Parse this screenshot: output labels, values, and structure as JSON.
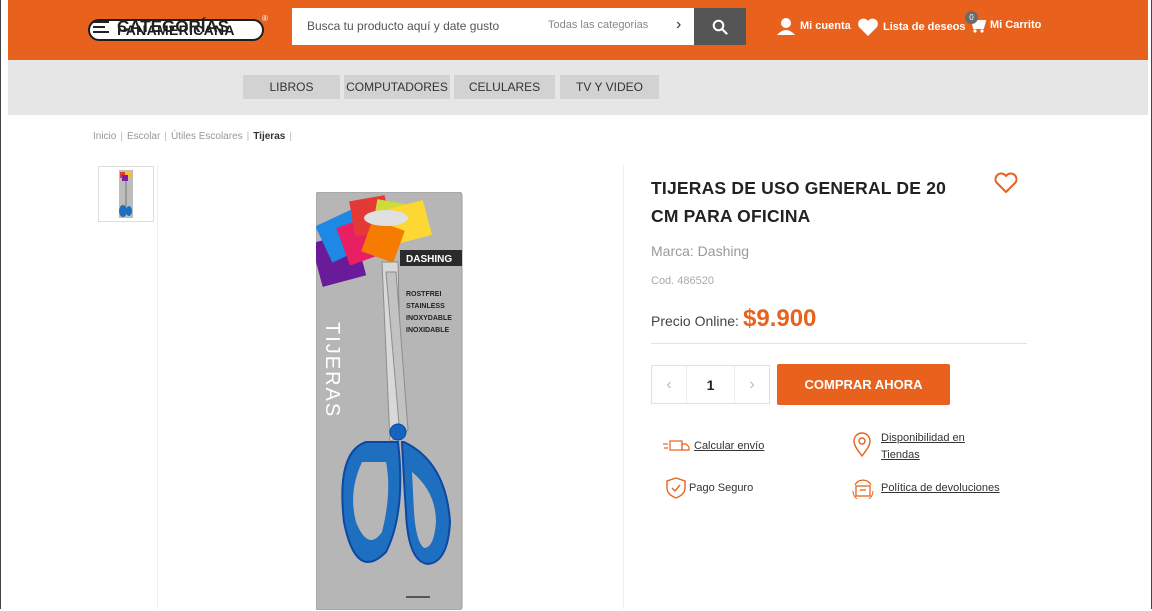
{
  "header": {
    "logo_text": "PANAMERICANA",
    "logo_mark": "®",
    "search_placeholder": "Busca tu producto aquí y date gusto",
    "search_category": "Todas las categorias",
    "account_label": "Mi cuenta",
    "wishlist_label": "Lista de deseos",
    "cart_label": "Mi Carrito",
    "cart_count": "0"
  },
  "categories": {
    "title": "CATEGORÍAS",
    "items": [
      "LIBROS",
      "COMPUTADORES",
      "CELULARES",
      "TV Y VIDEO"
    ]
  },
  "breadcrumb": [
    "Inicio",
    "Escolar",
    "Útiles Escolares",
    "Tijeras"
  ],
  "product": {
    "title": "TIJERAS DE USO GENERAL DE 20 CM PARA OFICINA",
    "brand": "Marca: Dashing",
    "code": "Cod. 486520",
    "price_label": "Precio Online:",
    "price": "$9.900",
    "quantity": "1",
    "buy_label": "COMPRAR AHORA",
    "package_brand": "DASHING",
    "package_label": "TIJERAS",
    "package_lines": [
      "ROSTFREI",
      "STAINLESS",
      "INOXYDABLE",
      "INOXIDABLE"
    ]
  },
  "features": {
    "shipping": "Calcular envío",
    "availability": "Disponibilidad en Tiendas",
    "secure": "Pago Seguro",
    "returns": "Política de devoluciones"
  },
  "colors": {
    "brand": "#e8621d",
    "category_bar": "#e6e6e6",
    "search_button": "#555555"
  }
}
